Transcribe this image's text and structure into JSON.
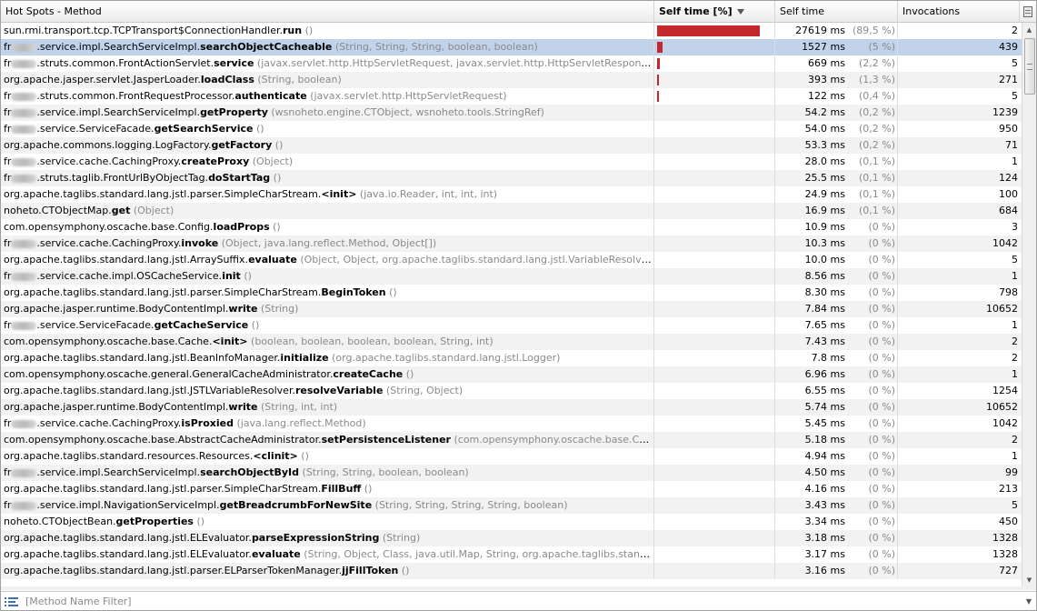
{
  "header": {
    "method": "Hot Spots - Method",
    "self_time_pct": "Self time [%]",
    "self_time": "Self time",
    "invocations": "Invocations"
  },
  "filter": {
    "placeholder": "[Method Name Filter]"
  },
  "colors": {
    "bar": "#c3282d",
    "selected_row": "#c1d3eb"
  },
  "rows": [
    {
      "pkg": "sun.rmi.transport.tcp.TCPTransport$ConnectionHandler.",
      "blur": false,
      "method": "run",
      "params": " ()",
      "time": "27619 ms",
      "pct": "(89,5 %)",
      "inv": "2",
      "frac": 0.895
    },
    {
      "pkg": "fr",
      "blur": true,
      "pkg2": ".service.impl.SearchServiceImpl.",
      "method": "searchObjectCacheable",
      "params": " (String, String, String, boolean, boolean)",
      "time": "1527 ms",
      "pct": "(5 %)",
      "inv": "439",
      "frac": 0.05,
      "selected": true
    },
    {
      "pkg": "fr",
      "blur": true,
      "pkg2": ".struts.common.FrontActionServlet.",
      "method": "service",
      "params": " (javax.servlet.http.HttpServletRequest, javax.servlet.http.HttpServletResponse)",
      "time": "669 ms",
      "pct": "(2,2 %)",
      "inv": "5",
      "frac": 0.022
    },
    {
      "pkg": "org.apache.jasper.servlet.JasperLoader.",
      "method": "loadClass",
      "params": " (String, boolean)",
      "time": "393 ms",
      "pct": "(1,3 %)",
      "inv": "271",
      "frac": 0.013
    },
    {
      "pkg": "fr",
      "blur": true,
      "pkg2": ".struts.common.FrontRequestProcessor.",
      "method": "authenticate",
      "params": " (javax.servlet.http.HttpServletRequest)",
      "time": "122 ms",
      "pct": "(0,4 %)",
      "inv": "5",
      "frac": 0.004
    },
    {
      "pkg": "fr",
      "blur": true,
      "pkg2": ".service.impl.SearchServiceImpl.",
      "method": "getProperty",
      "params": " (wsnoheto.engine.CTObject, wsnoheto.tools.StringRef)",
      "time": "54.2 ms",
      "pct": "(0,2 %)",
      "inv": "1239",
      "frac": 0.002
    },
    {
      "pkg": "fr",
      "blur": true,
      "pkg2": ".service.ServiceFacade.",
      "method": "getSearchService",
      "params": " ()",
      "time": "54.0 ms",
      "pct": "(0,2 %)",
      "inv": "950",
      "frac": 0.002
    },
    {
      "pkg": "org.apache.commons.logging.LogFactory.",
      "method": "getFactory",
      "params": " ()",
      "time": "53.3 ms",
      "pct": "(0,2 %)",
      "inv": "71",
      "frac": 0.002
    },
    {
      "pkg": "fr",
      "blur": true,
      "pkg2": ".service.cache.CachingProxy.",
      "method": "createProxy",
      "params": " (Object)",
      "time": "28.0 ms",
      "pct": "(0,1 %)",
      "inv": "1",
      "frac": 0.001
    },
    {
      "pkg": "fr",
      "blur": true,
      "pkg2": ".struts.taglib.FrontUrlByObjectTag.",
      "method": "doStartTag",
      "params": " ()",
      "time": "25.5 ms",
      "pct": "(0,1 %)",
      "inv": "124",
      "frac": 0.001
    },
    {
      "pkg": "org.apache.taglibs.standard.lang.jstl.parser.SimpleCharStream.",
      "method": "<init>",
      "params": " (java.io.Reader, int, int, int)",
      "time": "24.9 ms",
      "pct": "(0,1 %)",
      "inv": "100",
      "frac": 0.001
    },
    {
      "pkg": "noheto.CTObjectMap.",
      "method": "get",
      "params": " (Object)",
      "time": "16.9 ms",
      "pct": "(0,1 %)",
      "inv": "684",
      "frac": 0.001
    },
    {
      "pkg": "com.opensymphony.oscache.base.Config.",
      "method": "loadProps",
      "params": " ()",
      "time": "10.9 ms",
      "pct": "(0 %)",
      "inv": "3",
      "frac": 0
    },
    {
      "pkg": "fr",
      "blur": true,
      "pkg2": ".service.cache.CachingProxy.",
      "method": "invoke",
      "params": " (Object, java.lang.reflect.Method, Object[])",
      "time": "10.3 ms",
      "pct": "(0 %)",
      "inv": "1042",
      "frac": 0
    },
    {
      "pkg": "org.apache.taglibs.standard.lang.jstl.ArraySuffix.",
      "method": "evaluate",
      "params": " (Object, Object, org.apache.taglibs.standard.lang.jstl.VariableResolver, java.util.M...",
      "time": "10.0 ms",
      "pct": "(0 %)",
      "inv": "5",
      "frac": 0
    },
    {
      "pkg": "fr",
      "blur": true,
      "pkg2": ".service.cache.impl.OSCacheService.",
      "method": "init",
      "params": " ()",
      "time": "8.56 ms",
      "pct": "(0 %)",
      "inv": "1",
      "frac": 0
    },
    {
      "pkg": "org.apache.taglibs.standard.lang.jstl.parser.SimpleCharStream.",
      "method": "BeginToken",
      "params": " ()",
      "time": "8.30 ms",
      "pct": "(0 %)",
      "inv": "798",
      "frac": 0
    },
    {
      "pkg": "org.apache.jasper.runtime.BodyContentImpl.",
      "method": "write",
      "params": " (String)",
      "time": "7.84 ms",
      "pct": "(0 %)",
      "inv": "10652",
      "frac": 0
    },
    {
      "pkg": "fr",
      "blur": true,
      "pkg2": ".service.ServiceFacade.",
      "method": "getCacheService",
      "params": " ()",
      "time": "7.65 ms",
      "pct": "(0 %)",
      "inv": "1",
      "frac": 0
    },
    {
      "pkg": "com.opensymphony.oscache.base.Cache.",
      "method": "<init>",
      "params": " (boolean, boolean, boolean, boolean, String, int)",
      "time": "7.43 ms",
      "pct": "(0 %)",
      "inv": "2",
      "frac": 0
    },
    {
      "pkg": "org.apache.taglibs.standard.lang.jstl.BeanInfoManager.",
      "method": "initialize",
      "params": " (org.apache.taglibs.standard.lang.jstl.Logger)",
      "time": "7.8 ms",
      "pct": "(0 %)",
      "inv": "2",
      "frac": 0
    },
    {
      "pkg": "com.opensymphony.oscache.general.GeneralCacheAdministrator.",
      "method": "createCache",
      "params": " ()",
      "time": "6.96 ms",
      "pct": "(0 %)",
      "inv": "1",
      "frac": 0
    },
    {
      "pkg": "org.apache.taglibs.standard.lang.jstl.JSTLVariableResolver.",
      "method": "resolveVariable",
      "params": " (String, Object)",
      "time": "6.55 ms",
      "pct": "(0 %)",
      "inv": "1254",
      "frac": 0
    },
    {
      "pkg": "org.apache.jasper.runtime.BodyContentImpl.",
      "method": "write",
      "params": " (String, int, int)",
      "time": "5.74 ms",
      "pct": "(0 %)",
      "inv": "10652",
      "frac": 0
    },
    {
      "pkg": "fr",
      "blur": true,
      "pkg2": ".service.cache.CachingProxy.",
      "method": "isProxied",
      "params": " (java.lang.reflect.Method)",
      "time": "5.45 ms",
      "pct": "(0 %)",
      "inv": "1042",
      "frac": 0
    },
    {
      "pkg": "com.opensymphony.oscache.base.AbstractCacheAdministrator.",
      "method": "setPersistenceListener",
      "params": " (com.opensymphony.oscache.base.Cache)",
      "time": "5.18 ms",
      "pct": "(0 %)",
      "inv": "2",
      "frac": 0
    },
    {
      "pkg": "org.apache.taglibs.standard.resources.Resources.",
      "method": "<clinit>",
      "params": " ()",
      "time": "4.94 ms",
      "pct": "(0 %)",
      "inv": "1",
      "frac": 0
    },
    {
      "pkg": "fr",
      "blur": true,
      "pkg2": ".service.impl.SearchServiceImpl.",
      "method": "searchObjectById",
      "params": " (String, String, boolean, boolean)",
      "time": "4.50 ms",
      "pct": "(0 %)",
      "inv": "99",
      "frac": 0
    },
    {
      "pkg": "org.apache.taglibs.standard.lang.jstl.parser.SimpleCharStream.",
      "method": "FillBuff",
      "params": " ()",
      "time": "4.16 ms",
      "pct": "(0 %)",
      "inv": "213",
      "frac": 0
    },
    {
      "pkg": "fr",
      "blur": true,
      "pkg2": ".service.impl.NavigationServiceImpl.",
      "method": "getBreadcrumbForNewSite",
      "params": " (String, String, String, String, boolean)",
      "time": "3.43 ms",
      "pct": "(0 %)",
      "inv": "5",
      "frac": 0
    },
    {
      "pkg": "noheto.CTObjectBean.",
      "method": "getProperties",
      "params": " ()",
      "time": "3.34 ms",
      "pct": "(0 %)",
      "inv": "450",
      "frac": 0
    },
    {
      "pkg": "org.apache.taglibs.standard.lang.jstl.ELEvaluator.",
      "method": "parseExpressionString",
      "params": " (String)",
      "time": "3.18 ms",
      "pct": "(0 %)",
      "inv": "1328",
      "frac": 0
    },
    {
      "pkg": "org.apache.taglibs.standard.lang.jstl.ELEvaluator.",
      "method": "evaluate",
      "params": " (String, Object, Class, java.util.Map, String, org.apache.taglibs.standard.lang.jstl.L...",
      "time": "3.17 ms",
      "pct": "(0 %)",
      "inv": "1328",
      "frac": 0
    },
    {
      "pkg": "org.apache.taglibs.standard.lang.jstl.parser.ELParserTokenManager.",
      "method": "jjFillToken",
      "params": " ()",
      "time": "3.16 ms",
      "pct": "(0 %)",
      "inv": "727",
      "frac": 0
    }
  ]
}
